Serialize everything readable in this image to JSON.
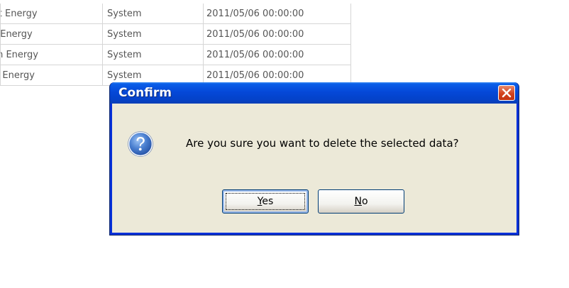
{
  "table": {
    "rows": [
      {
        "name": "st Energy",
        "user": "System",
        "date": "2011/05/06 00:00:00"
      },
      {
        "name": "t Energy",
        "user": "System",
        "date": "2011/05/06 00:00:00"
      },
      {
        "name": "th Energy",
        "user": "System",
        "date": "2011/05/06 00:00:00"
      },
      {
        "name": "d Energy",
        "user": "System",
        "date": "2011/05/06 00:00:00"
      }
    ]
  },
  "dialog": {
    "title": "Confirm",
    "message": "Are you sure you want to delete the selected data?",
    "icon": "question-icon",
    "close_icon": "close-icon",
    "yes": {
      "accel": "Y",
      "rest": "es"
    },
    "no": {
      "accel": "N",
      "rest": "o"
    }
  },
  "colors": {
    "titlebar": "#0548d8",
    "client": "#ece9d8",
    "close": "#d3421e"
  }
}
